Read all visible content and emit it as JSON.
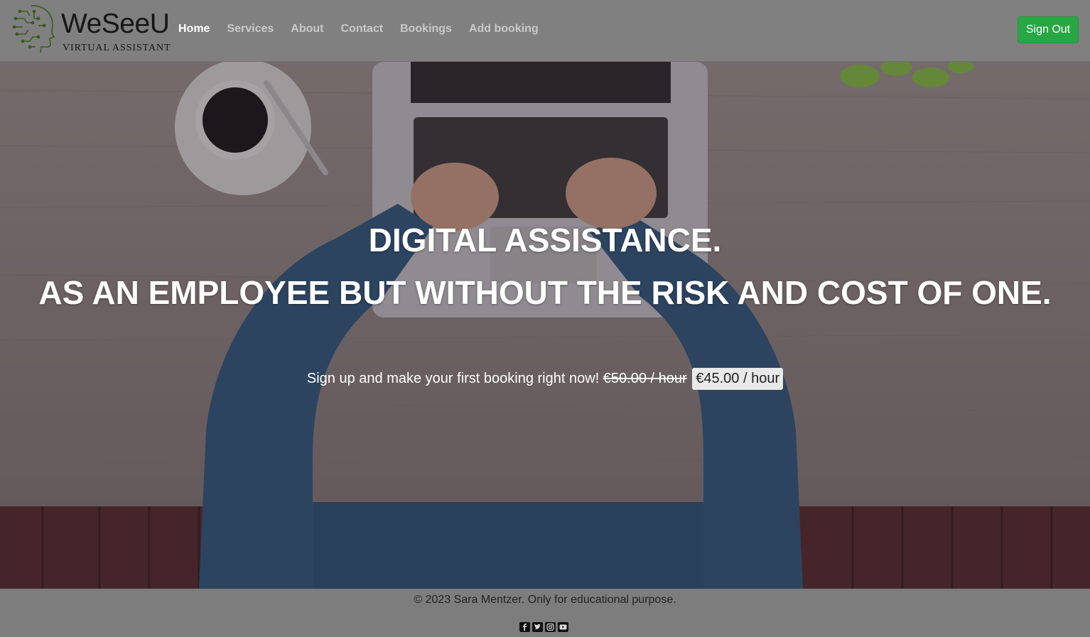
{
  "brand": {
    "name": "WeSeeU",
    "tagline": "VIRTUAL ASSISTANT"
  },
  "nav": {
    "links": [
      {
        "label": "Home",
        "active": true
      },
      {
        "label": "Services",
        "active": false
      },
      {
        "label": "About",
        "active": false
      },
      {
        "label": "Contact",
        "active": false
      },
      {
        "label": "Bookings",
        "active": false
      },
      {
        "label": "Add booking",
        "active": false
      }
    ],
    "signout_label": "Sign Out"
  },
  "hero": {
    "headline_1": "DIGITAL ASSISTANCE.",
    "headline_2": "AS AN EMPLOYEE BUT WITHOUT THE RISK AND COST OF ONE.",
    "offer_text": "Sign up and make your first booking right now!",
    "old_price": "€50.00 / hour",
    "new_price": "€45.00 / hour"
  },
  "footer": {
    "copyright": "© 2023 Sara Mentzer. Only for educational purpose.",
    "social_icons": [
      "facebook-icon",
      "twitter-icon",
      "instagram-icon",
      "youtube-icon"
    ]
  },
  "colors": {
    "navbar_bg": "#808080",
    "signout_bg": "#28a745",
    "active_link": "#ffffff",
    "inactive_link": "#c9c9c9"
  }
}
